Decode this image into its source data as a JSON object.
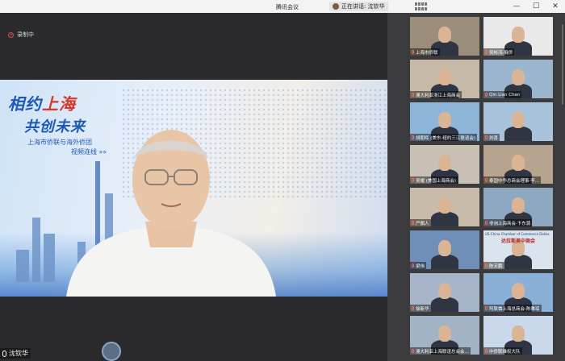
{
  "window": {
    "title": "腾讯会议",
    "speaking": "正在讲话: 沈钦华"
  },
  "recording": {
    "label": "录制中"
  },
  "main_video": {
    "banner_line1_a": "相约",
    "banner_line1_b": "上海",
    "banner_line2": "共创未来",
    "banner_sub1": "上海市侨联与海外侨团",
    "banner_sub2": "视频连线 »»",
    "speaker_name": "沈钦华"
  },
  "participants": [
    {
      "label": "上海市侨联",
      "bg": "#9a8d7a"
    },
    {
      "label": "倪彬鸿·俄侨",
      "bg": "#e9e9e9"
    },
    {
      "label": "澳大利亚浙江上海商会",
      "bg": "#c7b9a8"
    },
    {
      "label": "Qin Lian Chen",
      "bg": "#9bb5cf"
    },
    {
      "label": "胡朝晖 (美东-纽约三江联谊会)",
      "bg": "#8fb4d9"
    },
    {
      "label": "刘喜",
      "bg": "#a9c3dd"
    },
    {
      "label": "吴耀 (美国上海商会)",
      "bg": "#c9c0b5"
    },
    {
      "label": "泰国中华总商会理事·李…",
      "bg": "#b6a48e"
    },
    {
      "label": "严佩人",
      "bg": "#c8bba9"
    },
    {
      "label": "非洲上海商会·卞东源",
      "bg": "#8fa8c2"
    },
    {
      "label": "梁伟",
      "bg": "#6f8fb8"
    },
    {
      "label": "陈天鹏",
      "bg": "#dbe3ee"
    },
    {
      "label": "徐新华",
      "bg": "#a6b5c9"
    },
    {
      "label": "阿联酋上海总商会-陈雅琼",
      "bg": "#8ab0d8"
    },
    {
      "label": "澳大利亚上海联谊总会会…",
      "bg": "#a2b3c6"
    },
    {
      "label": "中侨联维权大队",
      "bg": "#c9d8ea"
    }
  ],
  "tile_texts": {
    "dallas_header": "US-China Chamber of Commerce Dallas",
    "dallas_cn": "达拉斯美中商会"
  }
}
